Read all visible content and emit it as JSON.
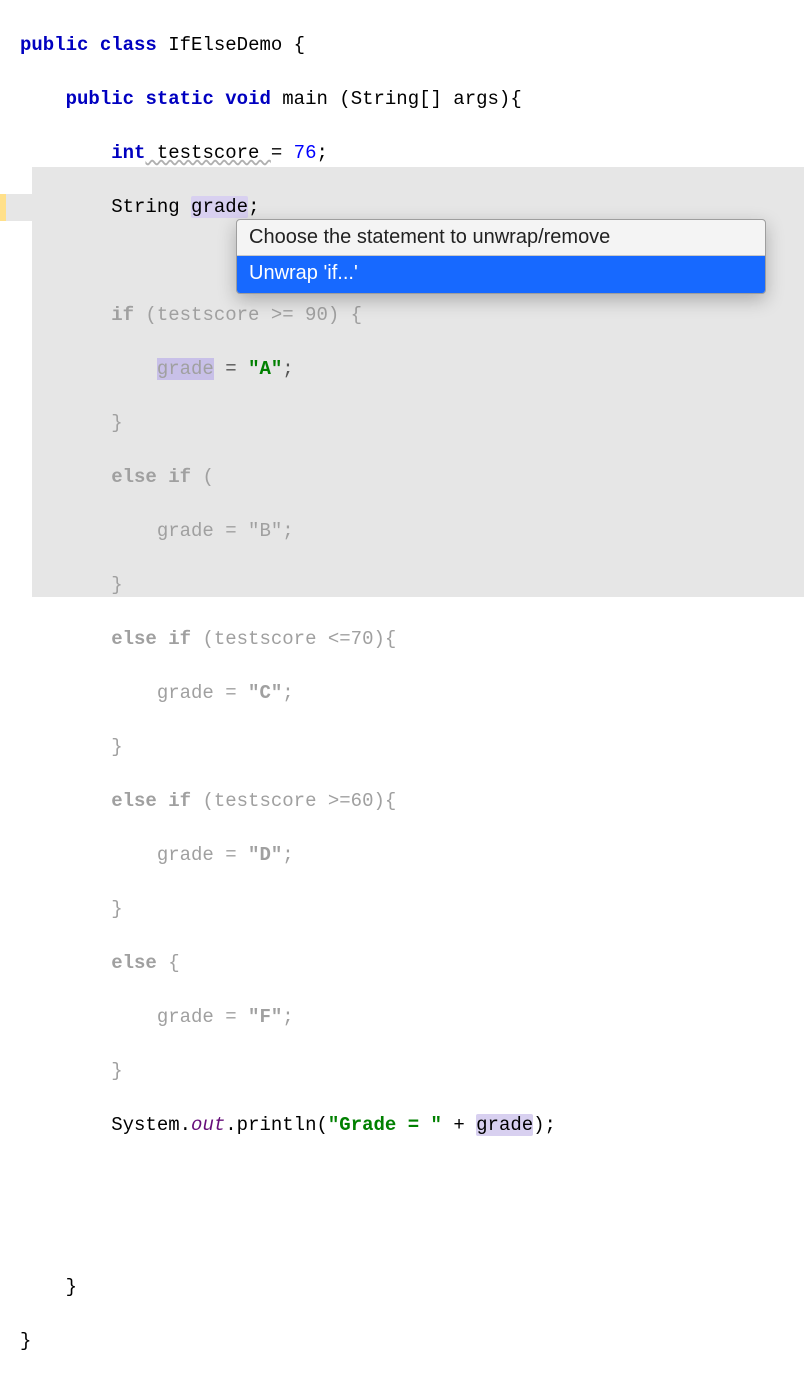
{
  "code": {
    "class_decl": {
      "kw1": "public",
      "kw2": "class",
      "name": "IfElseDemo",
      "brace": " {"
    },
    "main_decl": {
      "kw1": "public",
      "kw2": "static",
      "kw3": "void",
      "name": "main",
      "params": " (String[] args){"
    },
    "testscore": {
      "kw": "int",
      "name": " testscore ",
      "eq": "= ",
      "val": "76",
      "semi": ";"
    },
    "grade_decl": {
      "type": "String ",
      "name": "grade",
      "semi": ";"
    },
    "if1": {
      "kw": "if",
      "cond": " (testscore >= 90) {"
    },
    "if1_body": {
      "lhs": "grade",
      "mid": " = ",
      "rhs": "\"A\"",
      "semi": ";"
    },
    "brace_close": "}",
    "elseif2": {
      "kw": "else if",
      "cond": " ("
    },
    "elseif2_body": {
      "txt": "grade = \"B\";"
    },
    "elseif3": {
      "kw": "else if",
      "cond": " (testscore <=70){"
    },
    "elseif3_body": {
      "lhs": "grade = ",
      "rhs": "\"C\"",
      "semi": ";"
    },
    "elseif4": {
      "kw": "else if",
      "cond": " (testscore >=60){"
    },
    "elseif4_body": {
      "lhs": "grade = ",
      "rhs": "\"D\"",
      "semi": ";"
    },
    "else5": {
      "kw": "else",
      "brace": " {"
    },
    "else5_body": {
      "lhs": "grade = ",
      "rhs": "\"F\"",
      "semi": ";"
    },
    "println": {
      "pre": "System.",
      "out": "out",
      "mid": ".println(",
      "str": "\"Grade = \"",
      "post": " + ",
      "arg": "grade",
      "end": ");"
    }
  },
  "popup": {
    "title": "Choose the statement to unwrap/remove",
    "item": "Unwrap 'if...'"
  }
}
